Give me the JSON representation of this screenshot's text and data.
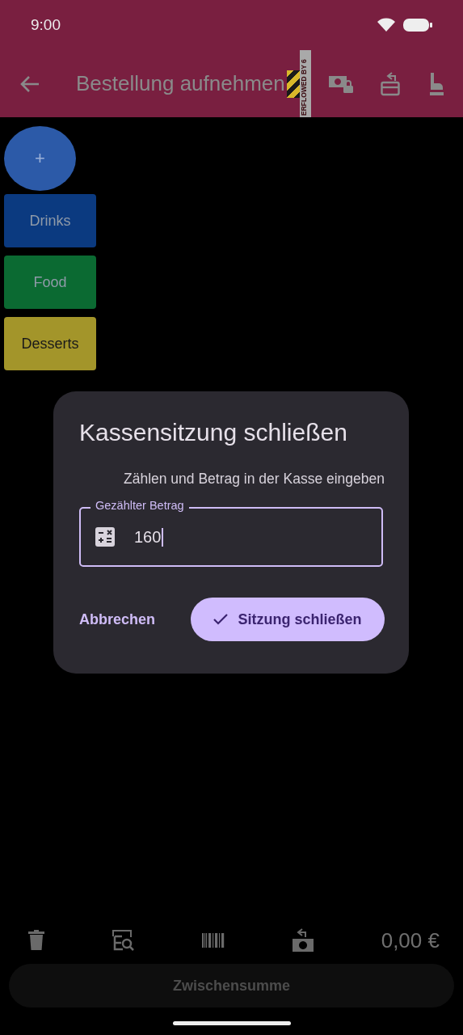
{
  "status_bar": {
    "time": "9:00"
  },
  "app_bar": {
    "title": "Bestellung aufnehmen",
    "overflow_label": "ERFLOWED BY 6"
  },
  "add_button": {
    "label": "+"
  },
  "categories": [
    {
      "label": "Drinks",
      "color": "#0b3a80"
    },
    {
      "label": "Food",
      "color": "#0b6a32"
    },
    {
      "label": "Desserts",
      "color": "#a3952a"
    }
  ],
  "dialog": {
    "title": "Kassensitzung schließen",
    "message": "Zählen und Betrag in der Kasse eingeben",
    "field": {
      "label": "Gezählter Betrag",
      "value": "160"
    },
    "actions": [
      {
        "label": "Abbrechen",
        "kind": "text"
      },
      {
        "label": "Sitzung schließen",
        "kind": "filled"
      }
    ]
  },
  "footer": {
    "total": "0,00 €",
    "button": {
      "label": "Zwischensumme",
      "disabled": true
    }
  }
}
